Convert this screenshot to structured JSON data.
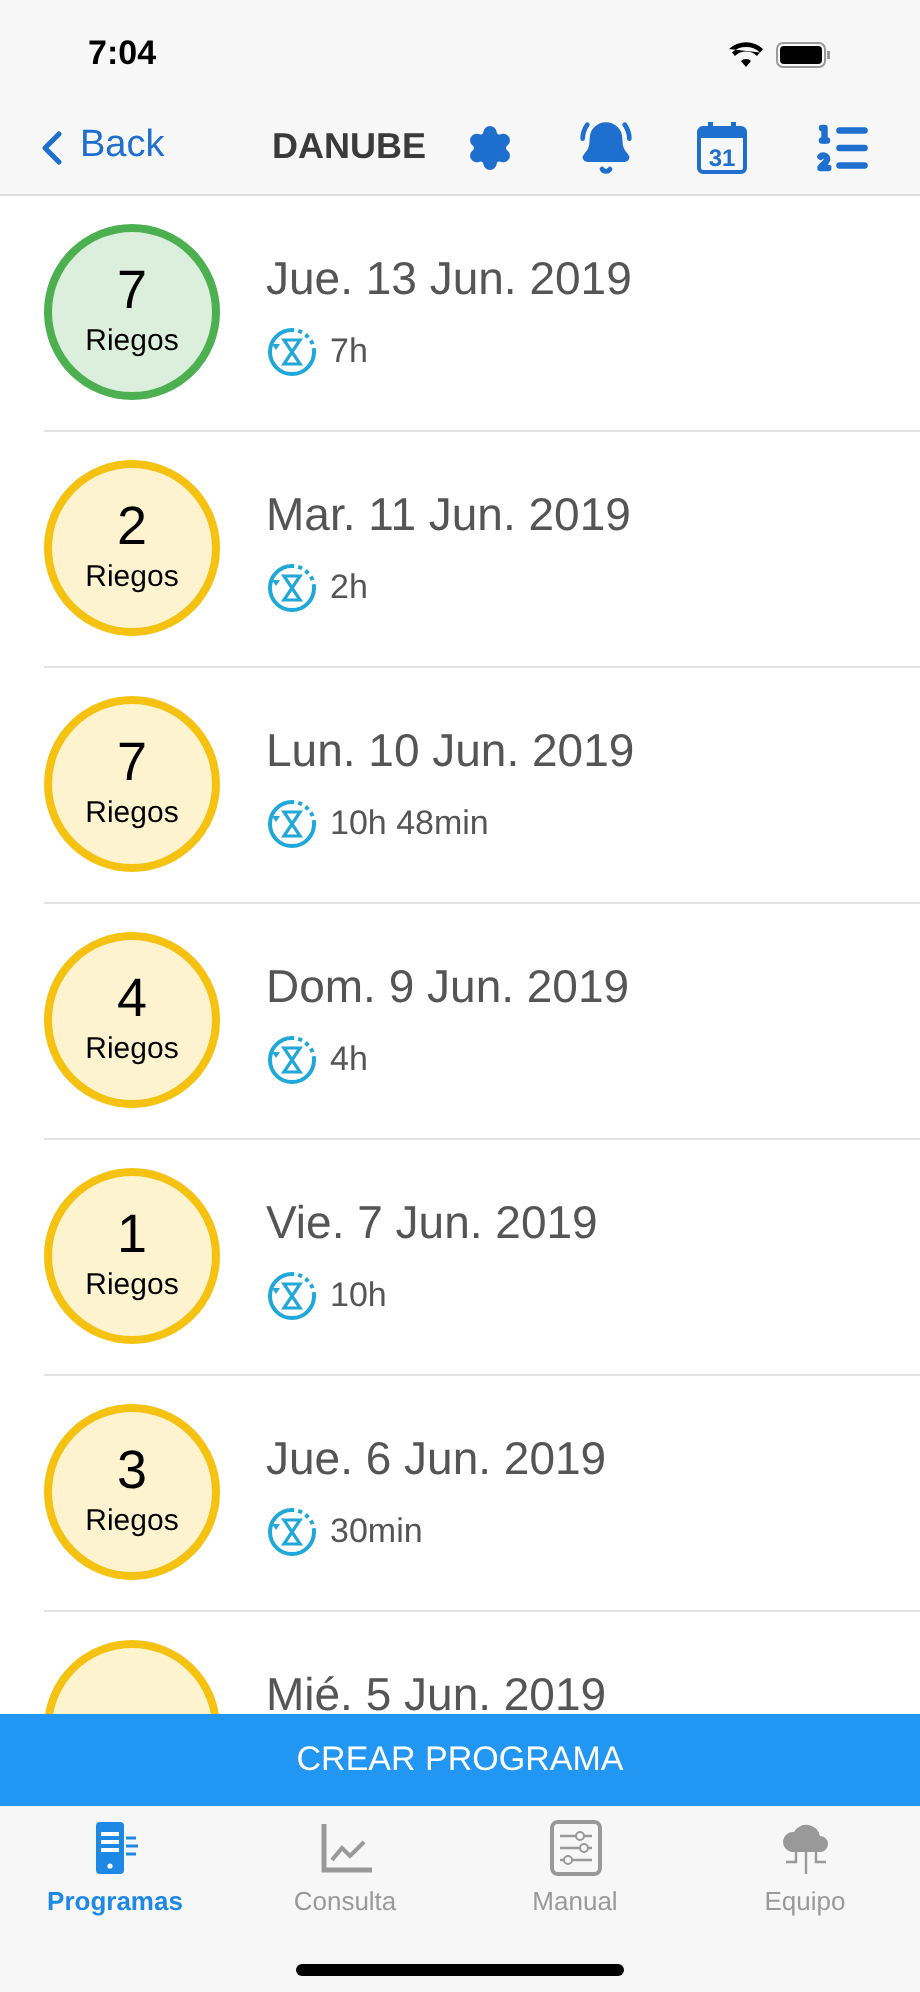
{
  "status_bar": {
    "time": "7:04"
  },
  "nav": {
    "back": "Back",
    "title": "DANUBE",
    "calendar_day": "31"
  },
  "items": [
    {
      "count": "7",
      "label": "Riegos",
      "date": "Jue. 13 Jun. 2019",
      "duration": "7h",
      "color": "#4caf50"
    },
    {
      "count": "2",
      "label": "Riegos",
      "date": "Mar. 11 Jun. 2019",
      "duration": "2h",
      "color": "#f5c211"
    },
    {
      "count": "7",
      "label": "Riegos",
      "date": "Lun. 10 Jun. 2019",
      "duration": "10h 48min",
      "color": "#f5c211"
    },
    {
      "count": "4",
      "label": "Riegos",
      "date": "Dom. 9 Jun. 2019",
      "duration": "4h",
      "color": "#f5c211"
    },
    {
      "count": "1",
      "label": "Riegos",
      "date": "Vie. 7 Jun. 2019",
      "duration": "10h",
      "color": "#f5c211"
    },
    {
      "count": "3",
      "label": "Riegos",
      "date": "Jue. 6 Jun. 2019",
      "duration": "30min",
      "color": "#f5c211"
    },
    {
      "date": "Mié. 5 Jun. 2019",
      "color": "#f5c211"
    }
  ],
  "create_button": "CREAR PROGRAMA",
  "tabs": [
    {
      "label": "Programas",
      "kind": "phone",
      "selected": true
    },
    {
      "label": "Consulta",
      "kind": "chart",
      "selected": false
    },
    {
      "label": "Manual",
      "kind": "sliders",
      "selected": false
    },
    {
      "label": "Equipo",
      "kind": "cloud",
      "selected": false
    }
  ]
}
